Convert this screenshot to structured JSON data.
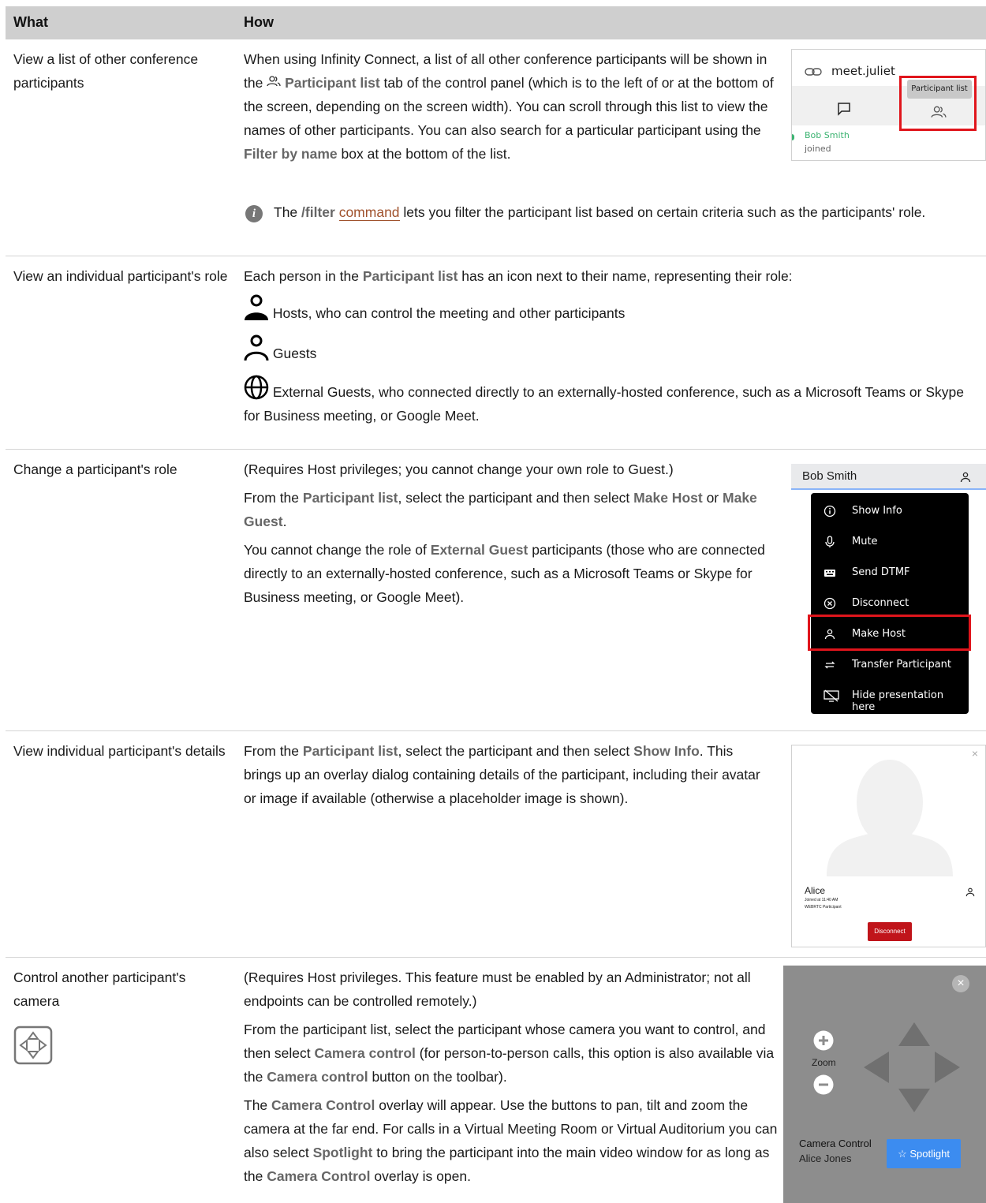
{
  "header": {
    "what": "What",
    "how": "How"
  },
  "r1": {
    "what": "View a list of other conference participants",
    "p1": "When using Infinity Connect, a list of all other conference participants will be shown in the",
    "p1_b": "Participant list",
    "p1b": "tab of the control panel (which is to the left of or at the bottom of the screen, depending on the screen width). You can scroll through this list to view the names of other participants. You can also search for a particular participant using the",
    "p1_b2": "Filter by name",
    "p1c": "box at the bottom of the list.",
    "note_a": "The",
    "note_b": "/filter",
    "note_link": "command",
    "note_c": "lets you filter the participant list based on certain criteria such as the participants' role.",
    "shot": {
      "meet": "meet.juliet",
      "tooltip": "Participant list",
      "name": "Bob Smith",
      "status": "joined"
    }
  },
  "r2": {
    "what": "View an individual participant's role",
    "p1a": "Each person in the",
    "p1b": "Participant list",
    "p1c": "has an icon next to their name, representing their role:",
    "hosts": "Hosts, who can control the meeting and other participants",
    "guests": "Guests",
    "external": "External Guests, who connected directly to an externally-hosted conference, such as a Microsoft Teams or Skype for Business meeting, or Google Meet."
  },
  "r3": {
    "what": "Change a participant's role",
    "p1": "(Requires Host privileges; you cannot change your own role to Guest.)",
    "p2a": "From the",
    "p2b": "Participant list",
    "p2c": ", select the participant and then select",
    "p2d": "Make Host",
    "p2e": "or",
    "p2f": "Make Guest",
    "p2g": ".",
    "p3a": "You cannot change the role of",
    "p3b": "External Guest",
    "p3c": "participants (those who are connected directly to an externally-hosted conference, such as a Microsoft Teams or Skype for Business meeting, or Google Meet).",
    "shot": {
      "name": "Bob Smith",
      "menu": [
        "Show Info",
        "Mute",
        "Send DTMF",
        "Disconnect",
        "Make Host",
        "Transfer Participant",
        "Hide presentation here"
      ]
    }
  },
  "r4": {
    "what": "View individual participant's details",
    "p1a": "From the",
    "p1b": "Participant list",
    "p1c": ", select the participant and then select",
    "p1d": "Show Info",
    "p1e": ". This brings up an overlay dialog containing details of the participant, including their avatar or image if available (otherwise a placeholder image is shown).",
    "shot": {
      "name": "Alice",
      "joined": "Joined at 11:40 AM",
      "type": "WEBRTC Participant",
      "btn": "Disconnect"
    }
  },
  "r5": {
    "what": "Control another participant's camera",
    "p1": "(Requires Host privileges. This feature must be enabled by an Administrator; not all endpoints can be controlled remotely.)",
    "p2a": "From the participant list, select the participant whose camera you want to control, and then select",
    "p2b": "Camera control",
    "p2c": "(for person-to-person calls, this option is also available via the",
    "p2d": "Camera control",
    "p2e": "button on the toolbar).",
    "p3a": "The",
    "p3b": "Camera Control",
    "p3c": "overlay will appear. Use the buttons to pan, tilt and zoom the camera at the far end. For calls in a Virtual Meeting Room or Virtual Auditorium you can also select",
    "p3d": "Spotlight",
    "p3e": "to bring the participant into the main video window for as long as the",
    "p3f": "Camera Control",
    "p3g": "overlay is open.",
    "shot": {
      "zoom": "Zoom",
      "title": "Camera Control",
      "name": "Alice Jones",
      "btn": "Spotlight"
    }
  }
}
